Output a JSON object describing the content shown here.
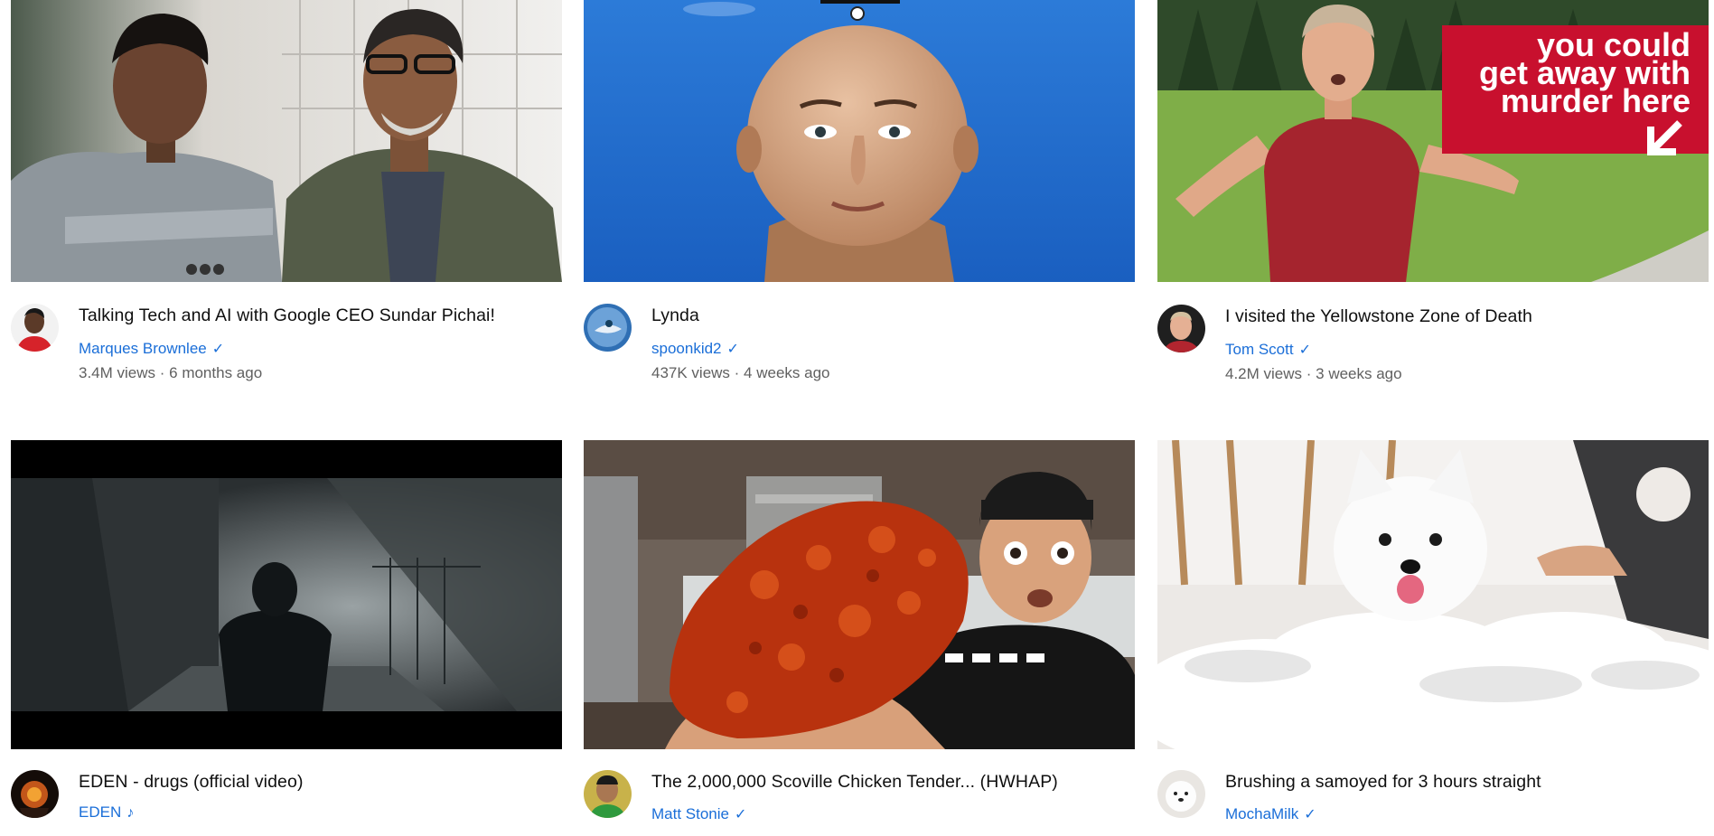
{
  "videos": [
    {
      "title": "Talking Tech and AI with Google CEO Sundar Pichai!",
      "channel": "Marques Brownlee",
      "badge": "✓",
      "views": "3.4M views",
      "age": "6 months ago"
    },
    {
      "title": "Lynda",
      "channel": "spoonkid2",
      "badge": "✓",
      "views": "437K views",
      "age": "4 weeks ago"
    },
    {
      "title": "I visited the Yellowstone Zone of Death",
      "channel": "Tom Scott",
      "badge": "✓",
      "views": "4.2M views",
      "age": "3 weeks ago",
      "thumb_text": [
        "you could",
        "get away with",
        "murder here"
      ]
    },
    {
      "title": "EDEN - drugs (official video)",
      "channel": "EDEN",
      "badge": "♪",
      "views": "",
      "age": ""
    },
    {
      "title": "The 2,000,000 Scoville Chicken Tender... (HWHAP)",
      "channel": "Matt Stonie",
      "badge": "✓",
      "views": "",
      "age": ""
    },
    {
      "title": "Brushing a samoyed for 3 hours straight",
      "channel": "MochaMilk",
      "badge": "✓",
      "views": "",
      "age": ""
    }
  ],
  "colors": {
    "title": "#0f0f0f",
    "channel_link": "#1a6ed8",
    "stats": "#606060",
    "thumb_badge": "#c8102e"
  }
}
